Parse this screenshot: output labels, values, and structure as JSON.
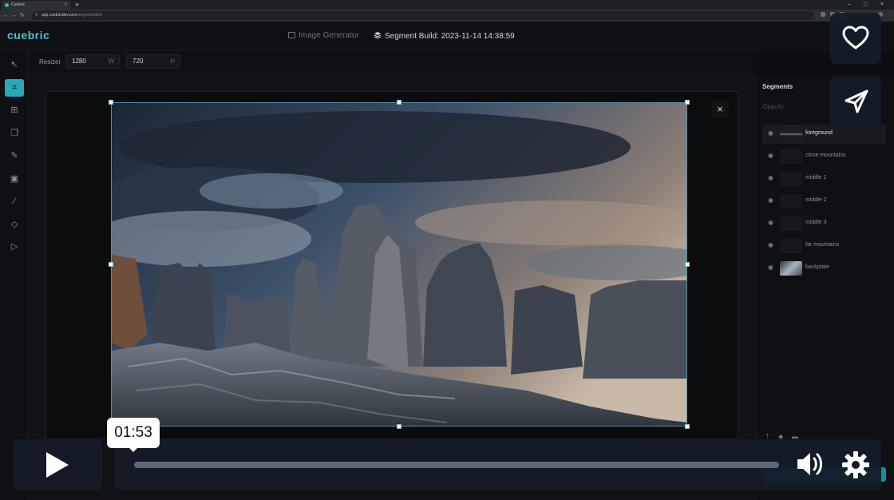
{
  "browser": {
    "tab_title": "Cuebric",
    "url_host": "app.cuebricdev.com",
    "url_path": "/segmentation",
    "new_tab": "+",
    "tab_close": "×",
    "nav_back": "←",
    "nav_forward": "→",
    "nav_reload": "↻",
    "win_min": "–",
    "win_max": "□",
    "win_close": "×",
    "lock": "⚲"
  },
  "app": {
    "logo": "cuebric",
    "image_generator_label": "Image Generator",
    "segment_build_label": "Segment Build: 2023-11-14 14:38:59"
  },
  "tools": [
    {
      "name": "select-tool",
      "icon": "↖"
    },
    {
      "name": "crop-tool",
      "icon": "⌗"
    },
    {
      "name": "resize-tool",
      "icon": "⊞"
    },
    {
      "name": "layers-tool",
      "icon": "❐"
    },
    {
      "name": "paint-tool",
      "icon": "✎"
    },
    {
      "name": "inpaint-tool",
      "icon": "▣"
    },
    {
      "name": "brush-tool",
      "icon": "⁄"
    },
    {
      "name": "eraser-tool",
      "icon": "◇"
    },
    {
      "name": "play-tool",
      "icon": "▷"
    }
  ],
  "resizer": {
    "label": "Resizer",
    "width_value": "1280",
    "width_unit": "W",
    "height_value": "720",
    "height_unit": "H"
  },
  "canvas": {
    "close_glyph": "×"
  },
  "segments_panel": {
    "title": "Segments",
    "opacity_label": "Opacity",
    "eye_glyph": "◉",
    "items": [
      {
        "name": "foreground",
        "selected": true
      },
      {
        "name": "close mountains",
        "selected": false
      },
      {
        "name": "middle 1",
        "selected": false
      },
      {
        "name": "middle 2",
        "selected": false
      },
      {
        "name": "middle 3",
        "selected": false
      },
      {
        "name": "far mountains",
        "selected": false
      },
      {
        "name": "backplate",
        "selected": false
      }
    ]
  },
  "player": {
    "current_time": "01:53"
  },
  "colors": {
    "accent": "#26a9b8",
    "logo": "#4fc4cf",
    "overlay": "#141c28"
  }
}
